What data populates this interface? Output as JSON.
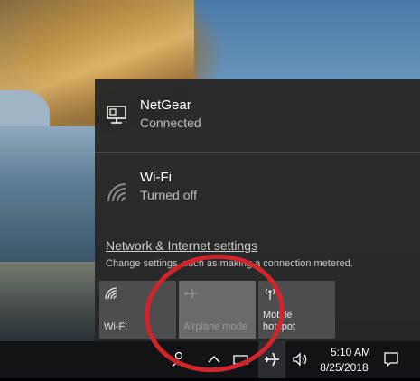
{
  "networks": [
    {
      "name": "NetGear",
      "status": "Connected",
      "icon": "ethernet-icon"
    },
    {
      "name": "Wi-Fi",
      "status": "Turned off",
      "icon": "wifi-icon"
    }
  ],
  "settings": {
    "link": "Network & Internet settings",
    "description": "Change settings, such as making a connection metered."
  },
  "quick_actions": [
    {
      "label": "Wi-Fi",
      "icon": "wifi-icon",
      "state": "off"
    },
    {
      "label": "Airplane mode",
      "icon": "airplane-icon",
      "state": "off"
    },
    {
      "label": "Mobile hotspot",
      "icon": "hotspot-icon",
      "state": "off"
    }
  ],
  "taskbar": {
    "time": "5:10 AM",
    "date": "8/25/2018"
  },
  "colors": {
    "flyout_bg": "#262626",
    "tile_bg": "#4d4d4d",
    "annotation": "#d0262b"
  }
}
